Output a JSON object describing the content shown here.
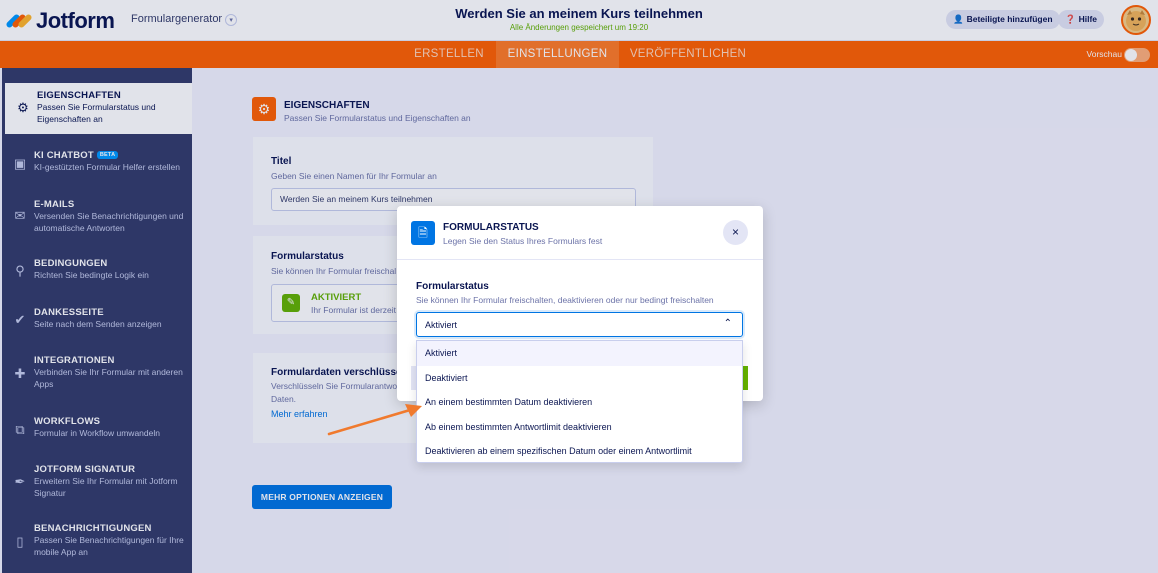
{
  "header": {
    "logo_text": "Jotform",
    "form_generator": "Formulargenerator",
    "form_title": "Werden Sie an meinem Kurs teilnehmen",
    "saved_status": "Alle Änderungen gespeichert um 19:20",
    "add_participants": "Beteiligte hinzufügen",
    "help": "Hilfe"
  },
  "nav": {
    "tabs": [
      "ERSTELLEN",
      "EINSTELLUNGEN",
      "VERÖFFENTLICHEN"
    ],
    "active_tab": "EINSTELLUNGEN",
    "preview": "Vorschau"
  },
  "sidebar": {
    "items": [
      {
        "title": "EIGENSCHAFTEN",
        "desc": "Passen Sie Formularstatus und Eigenschaften an",
        "icon": "gear-icon"
      },
      {
        "title": "KI CHATBOT",
        "badge": "BETA",
        "desc": "KI-gestützten Formular Helfer erstellen",
        "icon": "robot-icon"
      },
      {
        "title": "E-MAILS",
        "desc": "Versenden Sie Benachrichtigungen und automatische Antworten",
        "icon": "envelope-icon"
      },
      {
        "title": "BEDINGUNGEN",
        "desc": "Richten Sie bedingte Logik ein",
        "icon": "conditions-icon"
      },
      {
        "title": "DANKESSEITE",
        "desc": "Seite nach dem Senden anzeigen",
        "icon": "check-circle-icon"
      },
      {
        "title": "INTEGRATIONEN",
        "desc": "Verbinden Sie Ihr Formular mit anderen Apps",
        "icon": "puzzle-icon"
      },
      {
        "title": "WORKFLOWS",
        "desc": "Formular in Workflow umwandeln",
        "icon": "workflow-icon"
      },
      {
        "title": "JOTFORM SIGNATUR",
        "desc": "Erweitern Sie Ihr Formular mit Jotform Signatur",
        "icon": "signature-icon"
      },
      {
        "title": "BENACHRICHTIGUNGEN",
        "desc": "Passen Sie Benachrichtigungen für Ihre mobile App an",
        "icon": "mobile-notification-icon"
      }
    ]
  },
  "main": {
    "section_title": "EIGENSCHAFTEN",
    "section_sub": "Passen Sie Formularstatus und Eigenschaften an",
    "title_label": "Titel",
    "title_sub": "Geben Sie einen Namen für Ihr Formular an",
    "title_value": "Werden Sie an meinem Kurs teilnehmen",
    "status_label": "Formularstatus",
    "status_sub": "Sie können Ihr Formular freischal",
    "status_value": "AKTIVIERT",
    "status_desc": "Ihr Formular ist derzeit",
    "encrypt_label": "Formulardaten verschlüssel",
    "encrypt_sub": "Verschlüsseln Sie Formularantwo",
    "encrypt_sub2": "Daten.",
    "learn_more": "Mehr erfahren",
    "more_options": "MEHR OPTIONEN ANZEIGEN"
  },
  "modal": {
    "title": "FORMULARSTATUS",
    "subtitle": "Legen Sie den Status Ihres Formulars fest",
    "field_label": "Formularstatus",
    "field_sub": "Sie können Ihr Formular freischalten, deaktivieren oder nur bedingt freischalten",
    "selected": "Aktiviert",
    "close": "×"
  },
  "dropdown": {
    "options": [
      "Aktiviert",
      "Deaktiviert",
      "An einem bestimmten Datum deaktivieren",
      "Ab einem bestimmten Antwortlimit deaktivieren",
      "Deaktivieren ab einem spezifischen Datum oder einem Antwortlimit"
    ],
    "selected_index": 0
  },
  "colors": {
    "accent_orange": "#ff6100",
    "sidebar": "#343c6a",
    "primary_blue": "#0075e3",
    "success_green": "#64b200",
    "annotation_arrow": "#f07a2e"
  }
}
